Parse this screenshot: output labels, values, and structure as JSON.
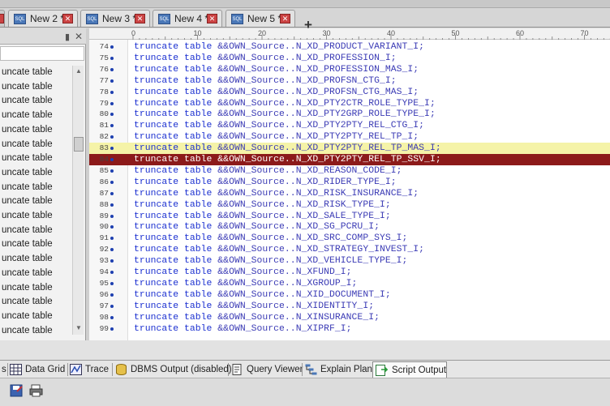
{
  "tabs": [
    {
      "label": "New 2 *"
    },
    {
      "label": "New 3 *"
    },
    {
      "label": "New 4 *"
    },
    {
      "label": "New 5 *"
    }
  ],
  "tab_icon_text": "SQL",
  "add_tab_label": "+",
  "left_panel": {
    "items": [
      "uncate table",
      "uncate table",
      "uncate table",
      "uncate table",
      "uncate table",
      "uncate table",
      "uncate table",
      "uncate table",
      "uncate table",
      "uncate table",
      "uncate table",
      "uncate table",
      "uncate table",
      "uncate table",
      "uncate table",
      "uncate table",
      "uncate table",
      "uncate table",
      "uncate table"
    ]
  },
  "ruler": {
    "ticks": [
      "0",
      "10",
      "20",
      "30",
      "40",
      "50",
      "60",
      "70"
    ]
  },
  "editor": {
    "lines": [
      {
        "n": "74",
        "kw": "truncate table",
        "rest": " &&OWN_Source..N_XD_PRODUCT_VARIANT_I;",
        "hl": ""
      },
      {
        "n": "75",
        "kw": "truncate table",
        "rest": " &&OWN_Source..N_XD_PROFESSION_I;",
        "hl": ""
      },
      {
        "n": "76",
        "kw": "truncate table",
        "rest": " &&OWN_Source..N_XD_PROFESSION_MAS_I;",
        "hl": ""
      },
      {
        "n": "77",
        "kw": "truncate table",
        "rest": " &&OWN_Source..N_XD_PROFSN_CTG_I;",
        "hl": ""
      },
      {
        "n": "78",
        "kw": "truncate table",
        "rest": " &&OWN_Source..N_XD_PROFSN_CTG_MAS_I;",
        "hl": ""
      },
      {
        "n": "79",
        "kw": "truncate table",
        "rest": " &&OWN_Source..N_XD_PTY2CTR_ROLE_TYPE_I;",
        "hl": ""
      },
      {
        "n": "80",
        "kw": "truncate table",
        "rest": " &&OWN_Source..N_XD_PTY2GRP_ROLE_TYPE_I;",
        "hl": ""
      },
      {
        "n": "81",
        "kw": "truncate table",
        "rest": " &&OWN_Source..N_XD_PTY2PTY_REL_CTG_I;",
        "hl": ""
      },
      {
        "n": "82",
        "kw": "truncate table",
        "rest": " &&OWN_Source..N_XD_PTY2PTY_REL_TP_I;",
        "hl": ""
      },
      {
        "n": "83",
        "kw": "truncate table",
        "rest": " &&OWN_Source..N_XD_PTY2PTY_REL_TP_MAS_I;",
        "hl": "yellow"
      },
      {
        "n": "84",
        "kw": "truncate table",
        "rest": " &&OWN_Source..N_XD_PTY2PTY_REL_TP_SSV_I;",
        "hl": "red"
      },
      {
        "n": "85",
        "kw": "truncate table",
        "rest": " &&OWN_Source..N_XD_REASON_CODE_I;",
        "hl": ""
      },
      {
        "n": "86",
        "kw": "truncate table",
        "rest": " &&OWN_Source..N_XD_RIDER_TYPE_I;",
        "hl": ""
      },
      {
        "n": "87",
        "kw": "truncate table",
        "rest": " &&OWN_Source..N_XD_RISK_INSURANCE_I;",
        "hl": ""
      },
      {
        "n": "88",
        "kw": "truncate table",
        "rest": " &&OWN_Source..N_XD_RISK_TYPE_I;",
        "hl": ""
      },
      {
        "n": "89",
        "kw": "truncate table",
        "rest": " &&OWN_Source..N_XD_SALE_TYPE_I;",
        "hl": ""
      },
      {
        "n": "90",
        "kw": "truncate table",
        "rest": " &&OWN_Source..N_XD_SG_PCRU_I;",
        "hl": ""
      },
      {
        "n": "91",
        "kw": "truncate table",
        "rest": " &&OWN_Source..N_XD_SRC_COMP_SYS_I;",
        "hl": ""
      },
      {
        "n": "92",
        "kw": "truncate table",
        "rest": " &&OWN_Source..N_XD_STRATEGY_INVEST_I;",
        "hl": ""
      },
      {
        "n": "93",
        "kw": "truncate table",
        "rest": " &&OWN_Source..N_XD_VEHICLE_TYPE_I;",
        "hl": ""
      },
      {
        "n": "94",
        "kw": "truncate table",
        "rest": " &&OWN_Source..N_XFUND_I;",
        "hl": ""
      },
      {
        "n": "95",
        "kw": "truncate table",
        "rest": " &&OWN_Source..N_XGROUP_I;",
        "hl": ""
      },
      {
        "n": "96",
        "kw": "truncate table",
        "rest": " &&OWN_Source..N_XID_DOCUMENT_I;",
        "hl": ""
      },
      {
        "n": "97",
        "kw": "truncate table",
        "rest": " &&OWN_Source..N_XIDENTITY_I;",
        "hl": ""
      },
      {
        "n": "98",
        "kw": "truncate table",
        "rest": " &&OWN_Source..N_XINSURANCE_I;",
        "hl": ""
      },
      {
        "n": "99",
        "kw": "truncate table",
        "rest": " &&OWN_Source..N_XIPRF_I;",
        "hl": ""
      }
    ]
  },
  "bottom_tabs": [
    {
      "label": "s",
      "icon": "partial-icon"
    },
    {
      "label": "Data Grid",
      "icon": "grid-icon"
    },
    {
      "label": "Trace",
      "icon": "trace-icon"
    },
    {
      "label": "DBMS Output (disabled)",
      "icon": "dbms-output-icon"
    },
    {
      "label": "Query Viewer",
      "icon": "query-viewer-icon"
    },
    {
      "label": "Explain Plan",
      "icon": "explain-plan-icon"
    },
    {
      "label": "Script Output",
      "icon": "script-output-icon"
    }
  ],
  "colors": {
    "keyword": "#1a2fd0",
    "current_line_highlight": "#8c1a1a",
    "secondary_highlight": "#f5f3a8"
  }
}
